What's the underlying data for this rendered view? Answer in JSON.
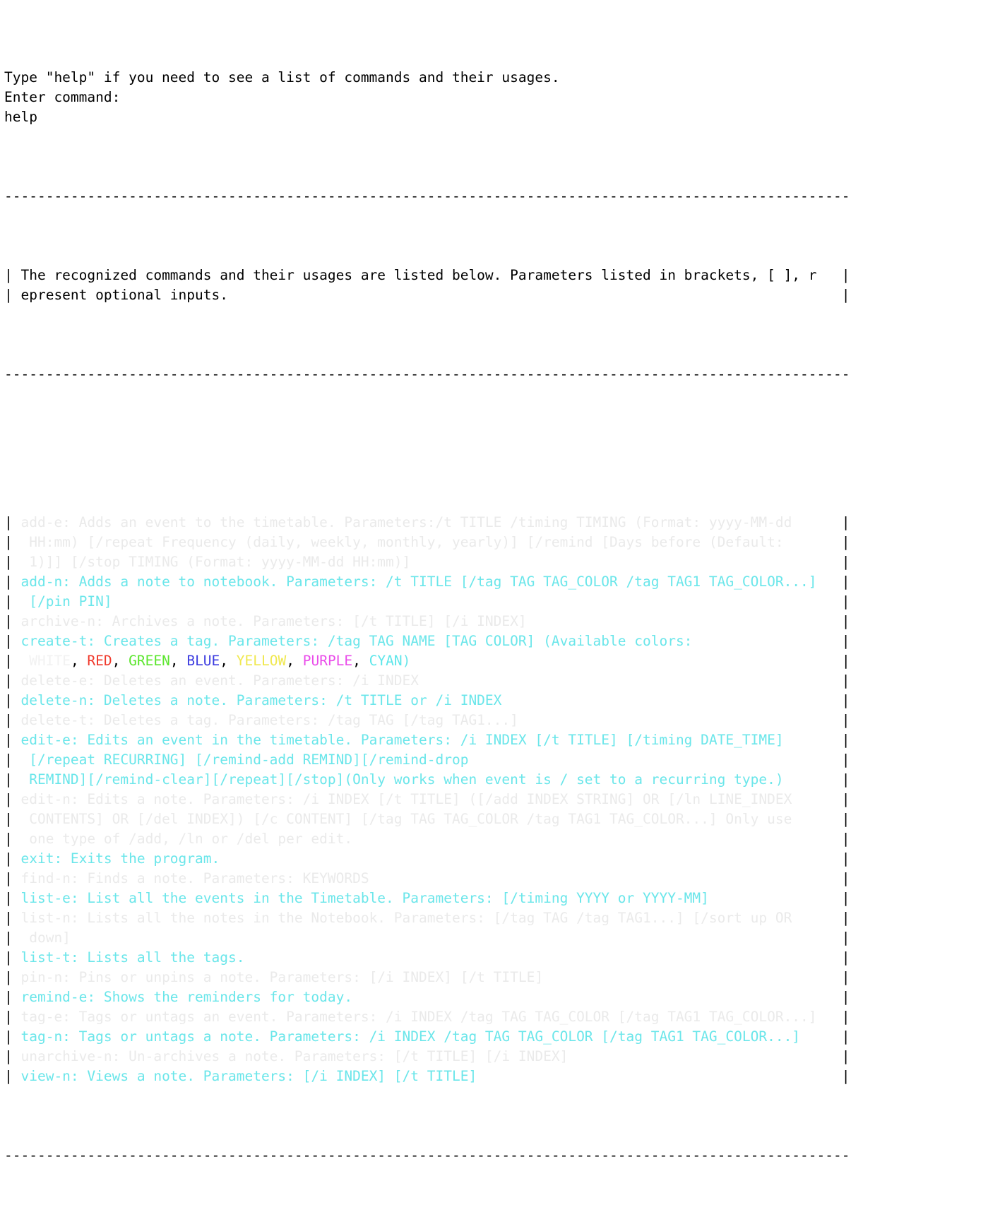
{
  "terminal": {
    "prompt_lines": [
      "Type \"help\" if you need to see a list of commands and their usages.",
      "Enter command:",
      "help"
    ],
    "divider": "------------------------------------------------------------------------------------------------------",
    "header_box": {
      "left_pipe": "|",
      "right_pipe": "|",
      "lines": [
        "The recognized commands and their usages are listed below. Parameters listed in brackets, [ ], r",
        "epresent optional inputs."
      ]
    },
    "colors": {
      "background": "#ffffff",
      "text": "#000000",
      "cyan": "#6be6ea",
      "faint": "#eaeaea",
      "white_tag": "#f2f2f2",
      "red_tag": "#f0392b",
      "green_tag": "#5ce62e",
      "blue_tag": "#3d3de0",
      "yellow_tag": "#f0e84f",
      "purple_tag": "#ea4cea",
      "cyan_tag": "#5ce6ea"
    },
    "commands": [
      {
        "name": "add-e",
        "style": "faint",
        "lines": [
          "add-e: Adds an event to the timetable. Parameters:/t TITLE /timing TIMING (Format: yyyy-MM-dd",
          " HH:mm) [/repeat Frequency (daily, weekly, monthly, yearly)] [/remind [Days before (Default:",
          " 1)]] [/stop TIMING (Format: yyyy-MM-dd HH:mm)]"
        ]
      },
      {
        "name": "add-n",
        "style": "cyan",
        "lines": [
          "add-n: Adds a note to notebook. Parameters: /t TITLE [/tag TAG TAG_COLOR /tag TAG1 TAG_COLOR...]",
          " [/pin PIN]"
        ]
      },
      {
        "name": "archive-n",
        "style": "faint",
        "lines": [
          "archive-n: Archives a note. Parameters: [/t TITLE] [/i INDEX]"
        ]
      },
      {
        "name": "create-t",
        "style": "cyan-colors",
        "lines": [
          "create-t: Creates a tag. Parameters: /tag TAG NAME [TAG COLOR] (Available colors:"
        ],
        "color_line": {
          "prefix": " ",
          "suffix": ")",
          "entries": [
            {
              "label": "WHITE",
              "style": "white"
            },
            {
              "label": "RED",
              "style": "red"
            },
            {
              "label": "GREEN",
              "style": "green"
            },
            {
              "label": "BLUE",
              "style": "blue"
            },
            {
              "label": "YELLOW",
              "style": "yellow"
            },
            {
              "label": "PURPLE",
              "style": "purple"
            },
            {
              "label": "CYAN",
              "style": "cyanv"
            }
          ],
          "separator": ", "
        }
      },
      {
        "name": "delete-e",
        "style": "faint",
        "lines": [
          "delete-e: Deletes an event. Parameters: /i INDEX"
        ]
      },
      {
        "name": "delete-n",
        "style": "cyan",
        "lines": [
          "delete-n: Deletes a note. Parameters: /t TITLE or /i INDEX"
        ]
      },
      {
        "name": "delete-t",
        "style": "faint",
        "lines": [
          "delete-t: Deletes a tag. Parameters: /tag TAG [/tag TAG1...]"
        ]
      },
      {
        "name": "edit-e",
        "style": "cyan",
        "lines": [
          "edit-e: Edits an event in the timetable. Parameters: /i INDEX [/t TITLE] [/timing DATE_TIME]",
          " [/repeat RECURRING] [/remind-add REMIND][/remind-drop",
          " REMIND][/remind-clear][/repeat][/stop](Only works when event is / set to a recurring type.)"
        ]
      },
      {
        "name": "edit-n",
        "style": "faint",
        "lines": [
          "edit-n: Edits a note. Parameters: /i INDEX [/t TITLE] ([/add INDEX STRING] OR [/ln LINE_INDEX",
          " CONTENTS] OR [/del INDEX]) [/c CONTENT] [/tag TAG TAG_COLOR /tag TAG1 TAG_COLOR...] Only use",
          " one type of /add, /ln or /del per edit."
        ]
      },
      {
        "name": "exit",
        "style": "cyan",
        "lines": [
          "exit: Exits the program."
        ]
      },
      {
        "name": "find-n",
        "style": "faint",
        "lines": [
          "find-n: Finds a note. Parameters: KEYWORDS"
        ]
      },
      {
        "name": "list-e",
        "style": "cyan",
        "lines": [
          "list-e: List all the events in the Timetable. Parameters: [/timing YYYY or YYYY-MM]"
        ]
      },
      {
        "name": "list-n",
        "style": "faint",
        "lines": [
          "list-n: Lists all the notes in the Notebook. Parameters: [/tag TAG /tag TAG1...] [/sort up OR",
          " down]"
        ]
      },
      {
        "name": "list-t",
        "style": "cyan",
        "lines": [
          "list-t: Lists all the tags."
        ]
      },
      {
        "name": "pin-n",
        "style": "faint",
        "lines": [
          "pin-n: Pins or unpins a note. Parameters: [/i INDEX] [/t TITLE]"
        ]
      },
      {
        "name": "remind-e",
        "style": "cyan",
        "lines": [
          "remind-e: Shows the reminders for today."
        ]
      },
      {
        "name": "tag-e",
        "style": "faint",
        "lines": [
          "tag-e: Tags or untags an event. Parameters: /i INDEX /tag TAG TAG_COLOR [/tag TAG1 TAG_COLOR...]"
        ]
      },
      {
        "name": "tag-n",
        "style": "cyan",
        "lines": [
          "tag-n: Tags or untags a note. Parameters: /i INDEX /tag TAG TAG_COLOR [/tag TAG1 TAG_COLOR...]"
        ]
      },
      {
        "name": "unarchive-n",
        "style": "faint",
        "lines": [
          "unarchive-n: Un-archives a note. Parameters: [/t TITLE] [/i INDEX]"
        ]
      },
      {
        "name": "view-n",
        "style": "cyan",
        "lines": [
          "view-n: Views a note. Parameters: [/i INDEX] [/t TITLE]"
        ]
      }
    ]
  }
}
